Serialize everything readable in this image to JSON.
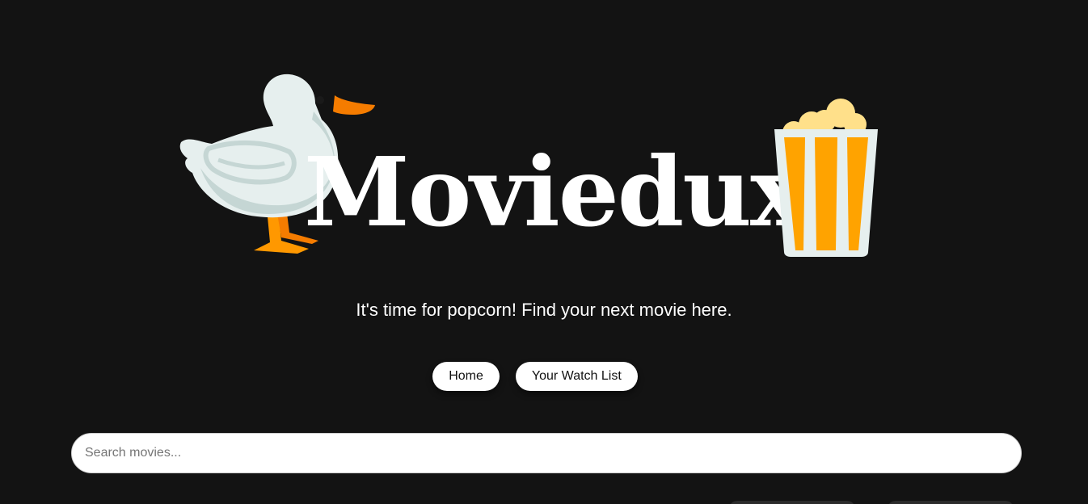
{
  "logo": {
    "text": "Moviedux",
    "duck_icon": "duck-icon",
    "popcorn_icon": "popcorn-icon"
  },
  "tagline": "It's time for popcorn! Find your next movie here.",
  "nav": {
    "items": [
      {
        "label": "Home"
      },
      {
        "label": "Your Watch List"
      }
    ]
  },
  "search": {
    "placeholder": "Search movies...",
    "value": ""
  },
  "colors": {
    "background": "#131313",
    "accent": "#ffa300",
    "text": "#ffffff"
  }
}
